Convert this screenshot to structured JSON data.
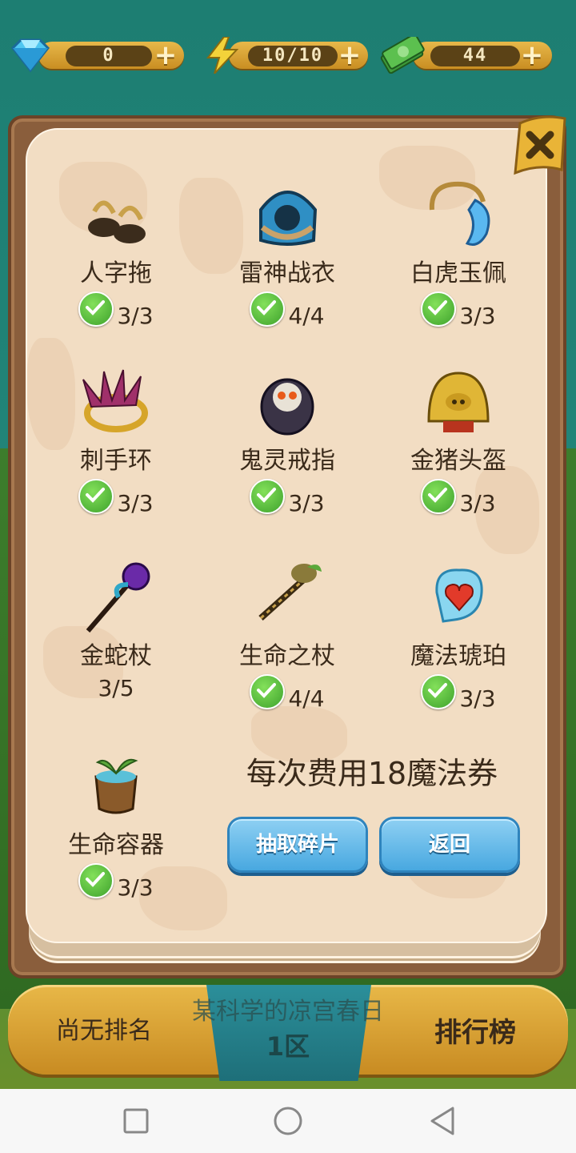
{
  "resources": {
    "diamonds": "0",
    "energy": "10/10",
    "cash": "44"
  },
  "items": [
    {
      "name": "人字拖",
      "count": "3/3",
      "complete": true,
      "icon": "sandals-icon"
    },
    {
      "name": "雷神战衣",
      "count": "4/4",
      "complete": true,
      "icon": "armor-icon"
    },
    {
      "name": "白虎玉佩",
      "count": "3/3",
      "complete": true,
      "icon": "jade-pendant-icon"
    },
    {
      "name": "刺手环",
      "count": "3/3",
      "complete": true,
      "icon": "spiked-bracelet-icon"
    },
    {
      "name": "鬼灵戒指",
      "count": "3/3",
      "complete": true,
      "icon": "skull-ring-icon"
    },
    {
      "name": "金猪头盔",
      "count": "3/3",
      "complete": true,
      "icon": "pig-helmet-icon"
    },
    {
      "name": "金蛇杖",
      "count": "3/5",
      "complete": false,
      "icon": "snake-staff-icon"
    },
    {
      "name": "生命之杖",
      "count": "4/4",
      "complete": true,
      "icon": "life-staff-icon"
    },
    {
      "name": "魔法琥珀",
      "count": "3/3",
      "complete": true,
      "icon": "heart-amber-icon"
    },
    {
      "name": "生命容器",
      "count": "3/3",
      "complete": true,
      "icon": "sprout-pot-icon"
    }
  ],
  "cost_text": "每次费用18魔法券",
  "buttons": {
    "draw": "抽取碎片",
    "back": "返回"
  },
  "bottom_bar": {
    "rank_status": "尚无排名",
    "player_name": "某科学的凉宫春日",
    "zone": "1区",
    "leaderboard": "排行榜"
  },
  "colors": {
    "check_green": "#4cb531",
    "button_blue": "#48a8e0",
    "panel_paper": "#f2ddc3"
  }
}
